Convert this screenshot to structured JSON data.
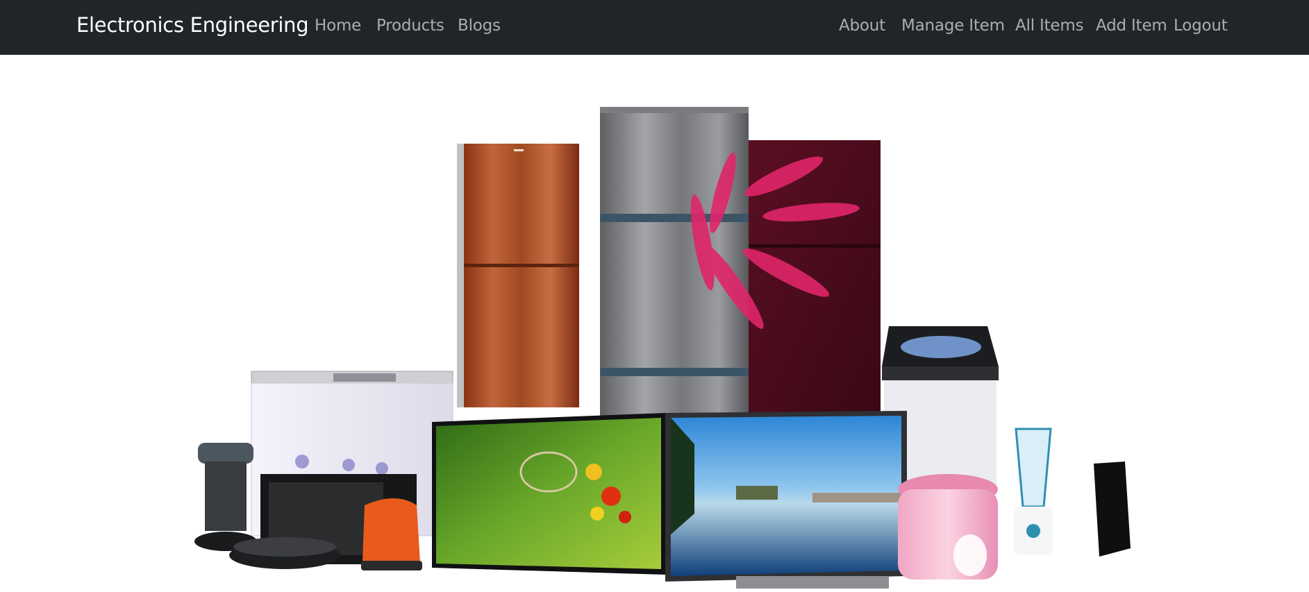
{
  "navbar": {
    "brand": "Electronics Engineering",
    "left_links": [
      {
        "label": "Home"
      },
      {
        "label": "Products"
      },
      {
        "label": "Blogs"
      }
    ],
    "right_links": [
      {
        "label": "About"
      },
      {
        "label": "Manage Item"
      },
      {
        "label": "All Items"
      },
      {
        "label": "Add Item"
      },
      {
        "label": "Logout"
      }
    ],
    "colors": {
      "background": "#212529",
      "brand_text": "#ffffff",
      "link_text": "rgba(255,255,255,0.62)"
    }
  },
  "hero": {
    "image_subject": "home-appliances-collage"
  }
}
